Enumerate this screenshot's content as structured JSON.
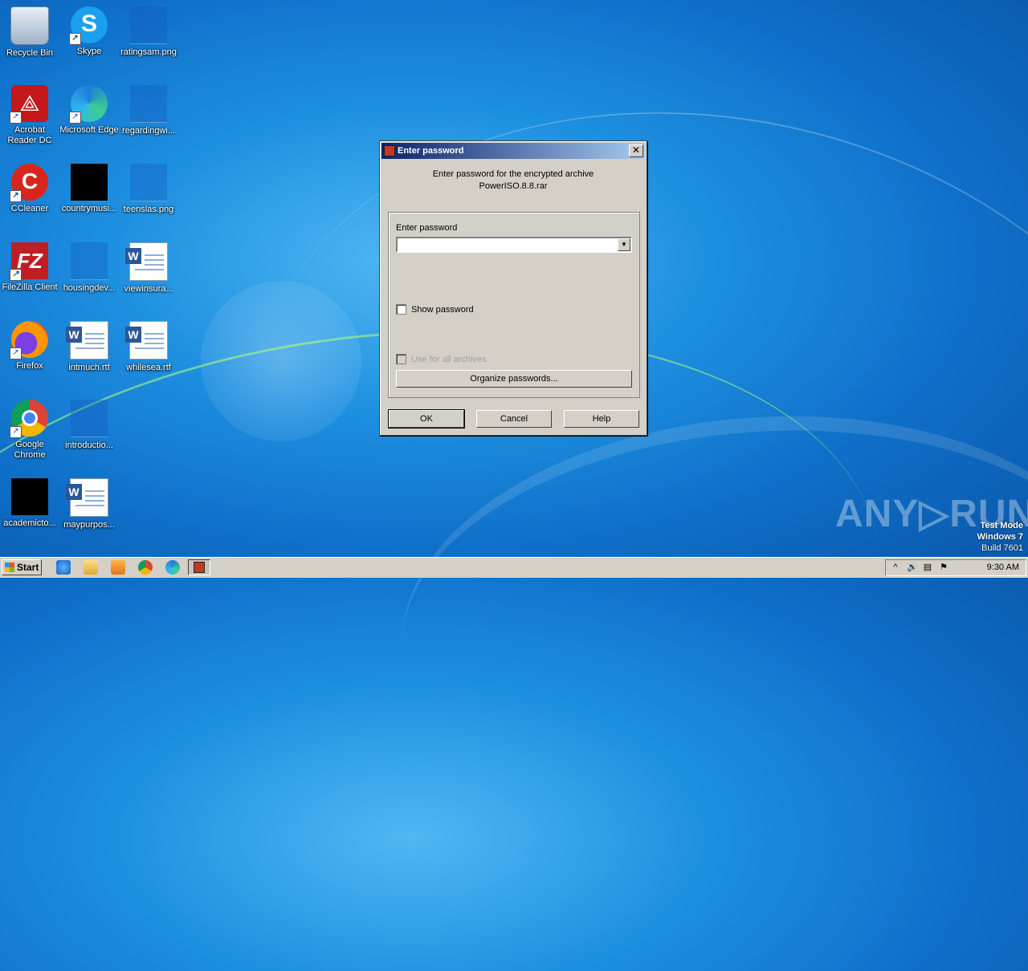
{
  "desktop_icons": [
    {
      "label": "Recycle Bin",
      "icon": "recycle-bin-icon"
    },
    {
      "label": "Skype",
      "icon": "skype-icon"
    },
    {
      "label": "ratingsam.png",
      "icon": "image-file-icon"
    },
    {
      "label": "Acrobat Reader DC",
      "icon": "acrobat-icon"
    },
    {
      "label": "Microsoft Edge",
      "icon": "edge-icon"
    },
    {
      "label": "regardingwi...",
      "icon": "image-file-icon"
    },
    {
      "label": "CCleaner",
      "icon": "ccleaner-icon"
    },
    {
      "label": "countrymusi...",
      "icon": "black-file-icon"
    },
    {
      "label": "teenslas.png",
      "icon": "image-file-icon"
    },
    {
      "label": "FileZilla Client",
      "icon": "filezilla-icon"
    },
    {
      "label": "housingdev...",
      "icon": "image-file-icon"
    },
    {
      "label": "viewinsura...",
      "icon": "word-doc-icon"
    },
    {
      "label": "Firefox",
      "icon": "firefox-icon"
    },
    {
      "label": "intmuch.rtf",
      "icon": "word-doc-icon"
    },
    {
      "label": "whilesea.rtf",
      "icon": "word-doc-icon"
    },
    {
      "label": "Google Chrome",
      "icon": "chrome-icon"
    },
    {
      "label": "introductio...",
      "icon": "image-file-icon"
    },
    {
      "label": "academicto...",
      "icon": "black-file-icon"
    },
    {
      "label": "maypurpos...",
      "icon": "word-doc-icon"
    }
  ],
  "dialog": {
    "title": "Enter password",
    "close_glyph": "✕",
    "message_line1": "Enter password for the encrypted archive",
    "message_line2": "PowerISO.8.8.rar",
    "password_label": "Enter password",
    "password_value": "",
    "show_password_label": "Show password",
    "use_for_all_label": "Use for all archives",
    "organize_label": "Organize passwords...",
    "ok_label": "OK",
    "cancel_label": "Cancel",
    "help_label": "Help"
  },
  "taskbar": {
    "start_label": "Start",
    "clock": "9:30 AM"
  },
  "watermark": {
    "brand": "ANY▷RUN",
    "line1": "Test Mode",
    "line2": "Windows 7",
    "line3": "Build 7601"
  }
}
